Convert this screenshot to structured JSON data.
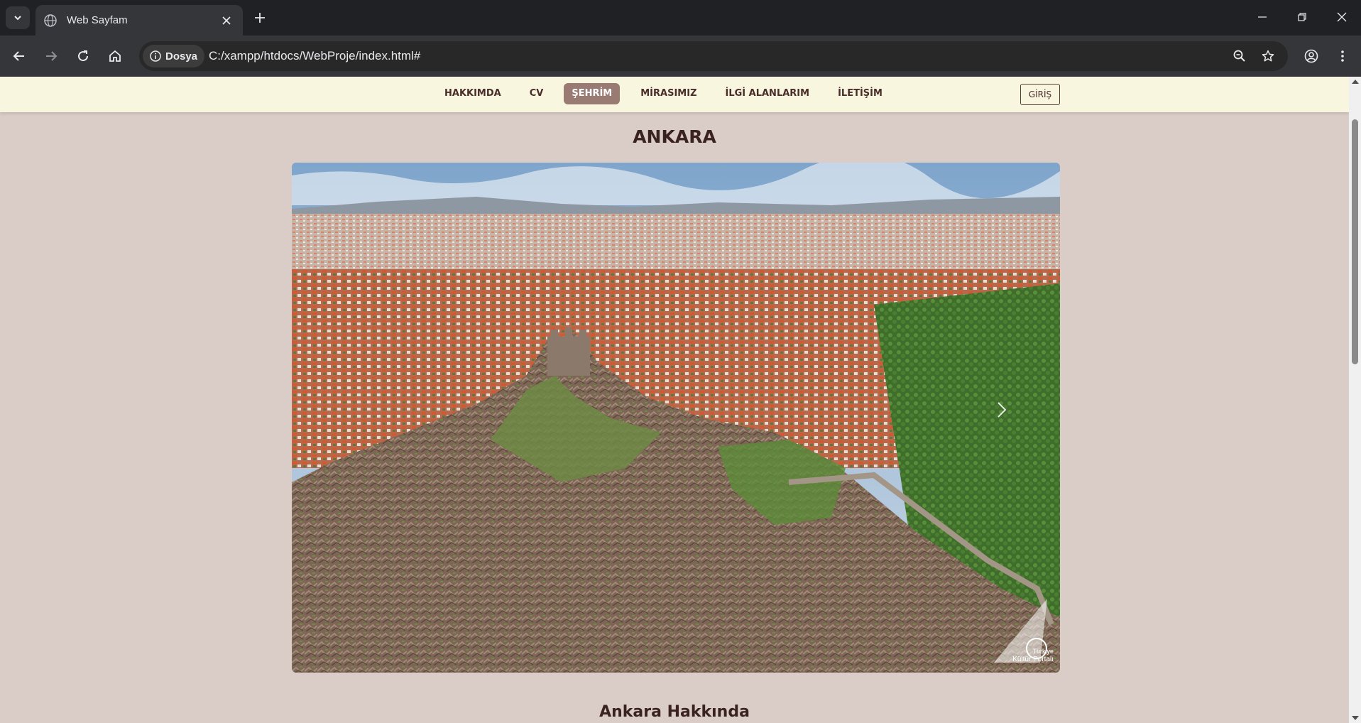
{
  "browser": {
    "tab_title": "Web Sayfam",
    "security_chip_label": "Dosya",
    "url": "C:/xampp/htdocs/WebProje/index.html#"
  },
  "site": {
    "nav_items": [
      {
        "label": "HAKKIMDA",
        "active": false
      },
      {
        "label": "CV",
        "active": false
      },
      {
        "label": "ŞEHRİM",
        "active": true
      },
      {
        "label": "MİRASIMIZ",
        "active": false
      },
      {
        "label": "İLGİ ALANLARIM",
        "active": false
      },
      {
        "label": "İLETİŞİM",
        "active": false
      }
    ],
    "login_label": "GİRİŞ",
    "page_title": "ANKARA",
    "section_title": "Ankara Hakkında",
    "watermark_line1": "Türkiye",
    "watermark_line2": "Kültür Portalı"
  },
  "colors": {
    "page_background": "#dacdc8",
    "navbar_background": "#f8f6df",
    "active_nav": "#9a7b73",
    "text_dark": "#3a2220"
  },
  "icons": {
    "tab_search": "chevron-down-icon",
    "favicon": "globe-icon",
    "back": "arrow-left-icon",
    "forward": "arrow-right-icon",
    "reload": "reload-icon",
    "home": "home-icon",
    "zoom": "zoom-out-icon",
    "bookmark": "star-icon",
    "profile": "profile-icon",
    "menu": "kebab-menu-icon",
    "carousel_next": "chevron-right-icon"
  }
}
